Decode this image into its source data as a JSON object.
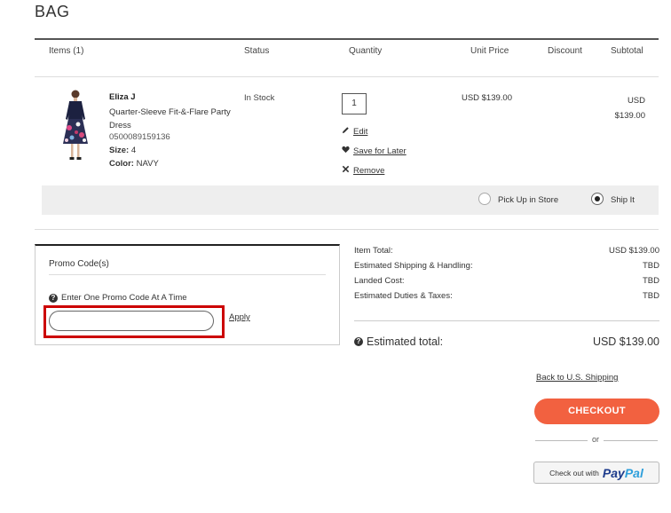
{
  "page": {
    "title": "BAG"
  },
  "table": {
    "headers": {
      "items": "Items (1)",
      "status": "Status",
      "quantity": "Quantity",
      "unit_price": "Unit Price",
      "discount": "Discount",
      "subtotal": "Subtotal"
    }
  },
  "item": {
    "brand": "Eliza J",
    "name": "Quarter-Sleeve Fit-&-Flare Party Dress",
    "sku": "0500089159136",
    "size_label": "Size:",
    "size_value": "4",
    "color_label": "Color:",
    "color_value": "NAVY",
    "status": "In Stock",
    "quantity": "1",
    "edit_label": "Edit",
    "save_later_label": "Save for Later",
    "remove_label": "Remove",
    "unit_price": "USD $139.00",
    "subtotal_currency": "USD",
    "subtotal_amount": "$139.00"
  },
  "fulfillment": {
    "pickup_label": "Pick Up in Store",
    "ship_label": "Ship It",
    "selected": "ship"
  },
  "promo": {
    "title": "Promo Code(s)",
    "hint": "Enter One Promo Code At A Time",
    "input_value": "",
    "apply_label": "Apply"
  },
  "summary": {
    "rows": [
      {
        "label": "Item Total:",
        "value": "USD $139.00"
      },
      {
        "label": "Estimated Shipping & Handling:",
        "value": "TBD"
      },
      {
        "label": "Landed Cost:",
        "value": "TBD"
      },
      {
        "label": "Estimated Duties & Taxes:",
        "value": "TBD"
      }
    ],
    "estimated_label": "Estimated total:",
    "estimated_value": "USD $139.00"
  },
  "actions": {
    "back_label": "Back to U.S. Shipping",
    "checkout_label": "CHECKOUT",
    "or_label": "or",
    "paypal_prefix": "Check out with",
    "paypal_brand_a": "Pay",
    "paypal_brand_b": "Pal"
  },
  "colors": {
    "checkout": "#f26140",
    "highlight": "#cc0000",
    "paypal_dark": "#1d3b8c",
    "paypal_light": "#2e9fdb"
  }
}
